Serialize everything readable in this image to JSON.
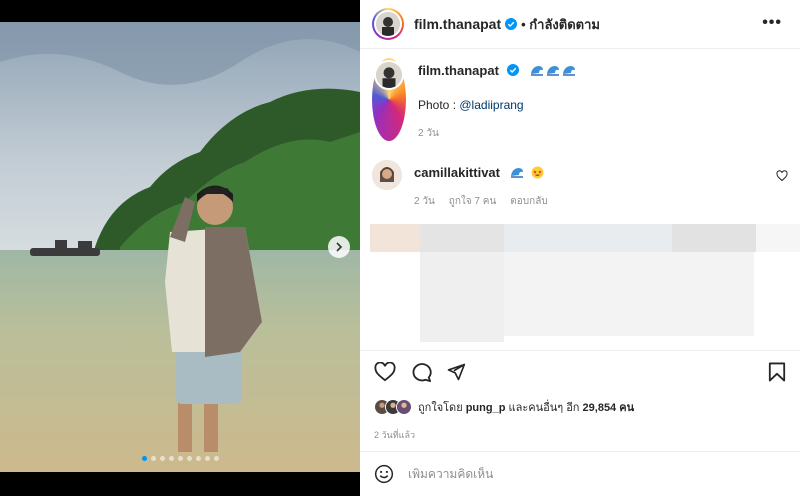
{
  "post": {
    "username": "film.thanapat",
    "follow_status": "• กำลังติดตาม",
    "more_label": "•••",
    "photo_credit_prefix": "Photo : ",
    "photo_credit_handle": "@ladiiprang",
    "caption_time": "2 วัน",
    "carousel_dots": 9,
    "carousel_active_index": 0
  },
  "comment": {
    "username": "camillakittivat",
    "time": "2 วัน",
    "likes": "ถูกใจ 7 คน",
    "reply_label": "ตอบกลับ"
  },
  "likes": {
    "prefix": "ถูกใจโดย",
    "user": "pung_p",
    "middle": "และคนอื่นๆ อีก",
    "count": "29,854",
    "suffix": "คน"
  },
  "post_date": "2 วันที่แล้ว",
  "composer": {
    "placeholder": "เพิ่มความคิดเห็น"
  },
  "colors": {
    "link": "#00376b",
    "verified": "#0095f6",
    "muted": "#8e8e8e"
  }
}
